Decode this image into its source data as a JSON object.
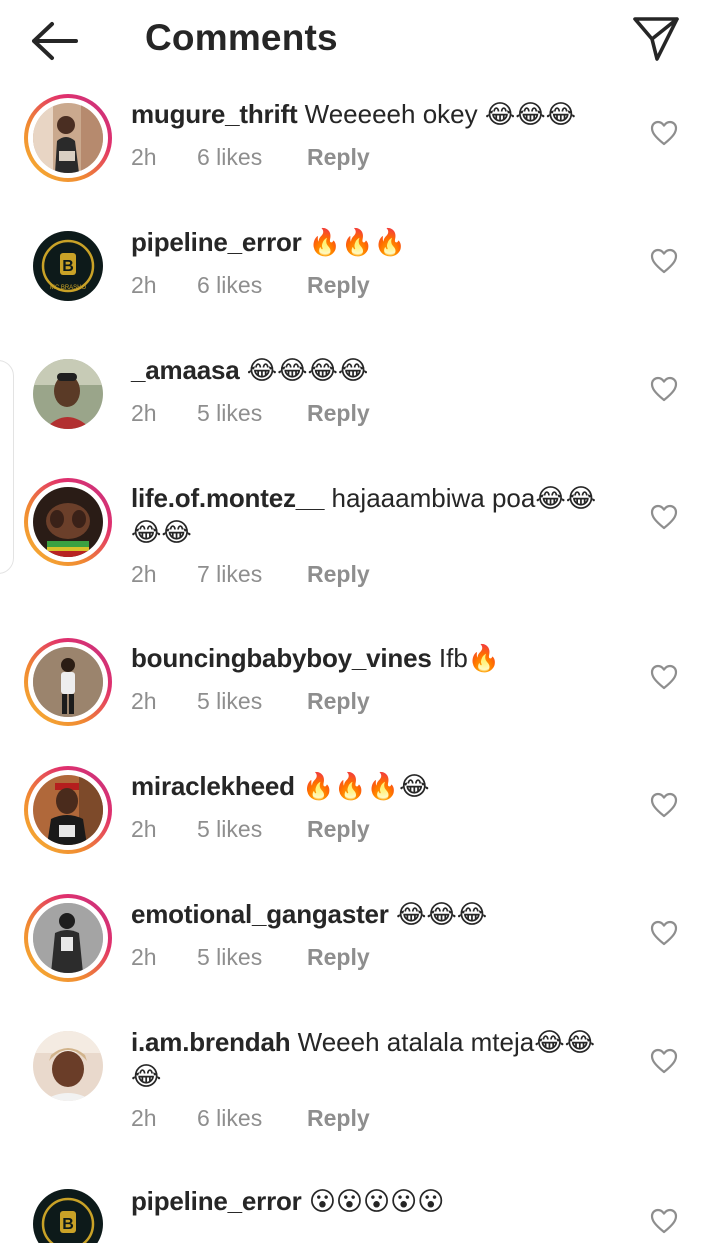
{
  "header": {
    "title": "Comments",
    "back_icon": "arrow-left-icon",
    "send_icon": "send-paper-plane-icon"
  },
  "colors": {
    "text": "#262626",
    "meta": "#8e8e8e",
    "ring_start": "#f7b733",
    "ring_end": "#c13584"
  },
  "comments": [
    {
      "username": "mugure_thrift",
      "text": "Weeeeeh okey 😂😂😂",
      "time": "2h",
      "likes": "6 likes",
      "reply": "Reply"
    },
    {
      "username": "pipeline_error",
      "text": "🔥🔥🔥",
      "time": "2h",
      "likes": "6 likes",
      "reply": "Reply"
    },
    {
      "username": "_amaasa",
      "text": "😂😂😂😂",
      "time": "2h",
      "likes": "5 likes",
      "reply": "Reply"
    },
    {
      "username": "life.of.montez__",
      "text": "hajaaambiwa poa😂😂😂😂",
      "time": "2h",
      "likes": "7 likes",
      "reply": "Reply"
    },
    {
      "username": "bouncingbabyboy_vines",
      "text": "Ifb🔥",
      "time": "2h",
      "likes": "5 likes",
      "reply": "Reply"
    },
    {
      "username": "miraclekheed",
      "text": "🔥🔥🔥😂",
      "time": "2h",
      "likes": "5 likes",
      "reply": "Reply"
    },
    {
      "username": "emotional_gangaster",
      "text": "😂😂😂",
      "time": "2h",
      "likes": "5 likes",
      "reply": "Reply"
    },
    {
      "username": "i.am.brendah",
      "text": "Weeeh atalala mteja😂😂😂",
      "time": "2h",
      "likes": "6 likes",
      "reply": "Reply"
    },
    {
      "username": "pipeline_error",
      "text": "😮😮😮😮😮",
      "time": "",
      "likes": "",
      "reply": ""
    }
  ],
  "avatar_badge": {
    "letter": "B",
    "caption": "MC BRASHO"
  },
  "heart_icon": "heart-outline-icon"
}
